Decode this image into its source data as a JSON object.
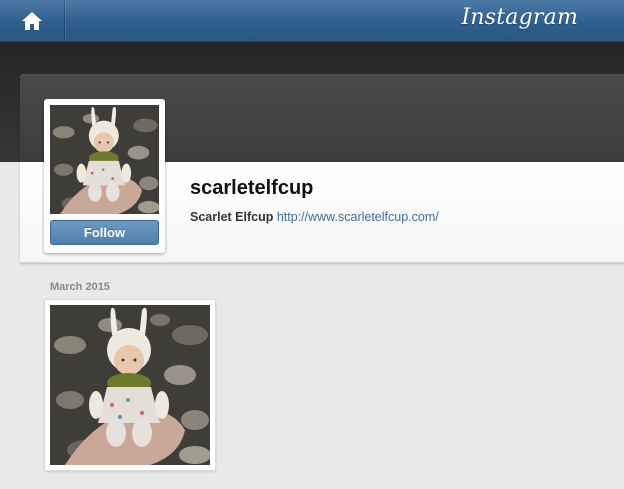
{
  "header": {
    "brand": "Instagram",
    "home_icon": "home-icon"
  },
  "profile": {
    "username": "scarletelfcup",
    "full_name": "Scarlet Elfcup",
    "website": "http://www.scarletelfcup.com/",
    "follow_label": "Follow",
    "avatar_subject": "knitted-doll-photo"
  },
  "feed": {
    "month_label": "March 2015",
    "photos": [
      {
        "subject": "knitted-doll-photo"
      }
    ]
  },
  "colors": {
    "topbar": "#2f5f8e",
    "follow_button": "#5a89b6",
    "link": "#3d6e9c"
  }
}
